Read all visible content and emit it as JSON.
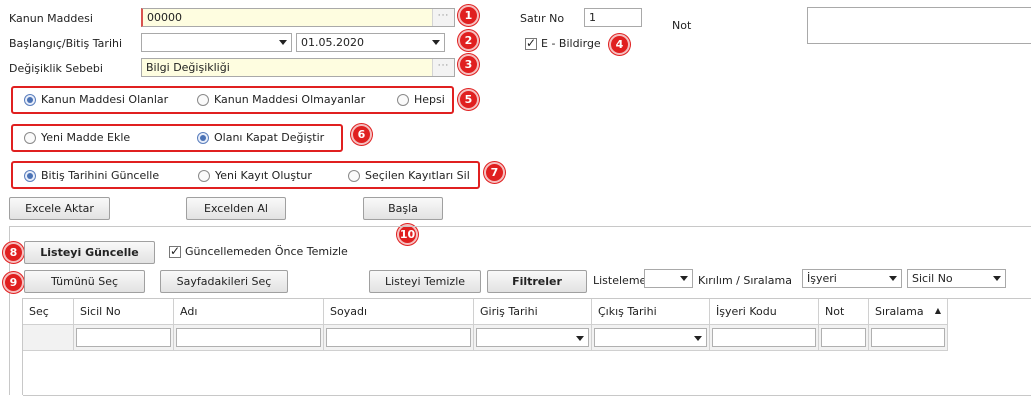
{
  "form": {
    "kanun_maddesi_label": "Kanun Maddesi",
    "kanun_maddesi_value": "00000",
    "baslangic_bitis_label": "Başlangıç/Bitiş Tarihi",
    "baslangic_value": "",
    "bitis_value": "01.05.2020",
    "degisiklik_sebebi_label": "Değişiklik Sebebi",
    "degisiklik_sebebi_value": "Bilgi Değişikliği",
    "ellipsis": "···",
    "satir_no_label": "Satır No",
    "satir_no_value": "1",
    "e_bildirge_label": "E - Bildirge",
    "e_bildirge_checked": true,
    "not_label": "Not",
    "not_value": ""
  },
  "radio_groups": {
    "group5": [
      {
        "label": "Kanun Maddesi Olanlar",
        "selected": true
      },
      {
        "label": "Kanun Maddesi Olmayanlar",
        "selected": false
      },
      {
        "label": "Hepsi",
        "selected": false
      }
    ],
    "group6": [
      {
        "label": "Yeni Madde Ekle",
        "selected": false
      },
      {
        "label": "Olanı Kapat Değiştir",
        "selected": true
      }
    ],
    "group7": [
      {
        "label": "Bitiş Tarihini Güncelle",
        "selected": true
      },
      {
        "label": "Yeni Kayıt Oluştur",
        "selected": false
      },
      {
        "label": "Seçilen Kayıtları Sil",
        "selected": false
      }
    ]
  },
  "buttons": {
    "excele_aktar": "Excele Aktar",
    "excelden_al": "Excelden Al",
    "basla": "Başla",
    "listeyi_guncelle": "Listeyi Güncelle",
    "tumunu_sec": "Tümünü Seç",
    "sayfadakileri_sec": "Sayfadakileri Seç",
    "listeyi_temizle": "Listeyi Temizle",
    "filtreler": "Filtreler"
  },
  "options": {
    "guncellemeden_once_temizle_label": "Güncellemeden Önce Temizle",
    "guncellemeden_once_temizle_checked": true,
    "listeleme_label": "Listeleme",
    "listeleme_value": "",
    "kirilim_label": "Kırılım / Sıralama",
    "kirilim_value": "İşyeri",
    "siralama_value": "Sicil No"
  },
  "badges": [
    "1",
    "2",
    "3",
    "4",
    "5",
    "6",
    "7",
    "8",
    "9",
    "10"
  ],
  "grid": {
    "columns": [
      "Seç",
      "Sicil No",
      "Adı",
      "Soyadı",
      "Giriş Tarihi",
      "Çıkış Tarihi",
      "İşyeri Kodu",
      "Not",
      "Sıralama"
    ],
    "sort_indicator": "▲"
  },
  "colors": {
    "badge_red": "#e02020",
    "yellow_field": "#fefde0",
    "radio_blue": "#4a72b5"
  }
}
